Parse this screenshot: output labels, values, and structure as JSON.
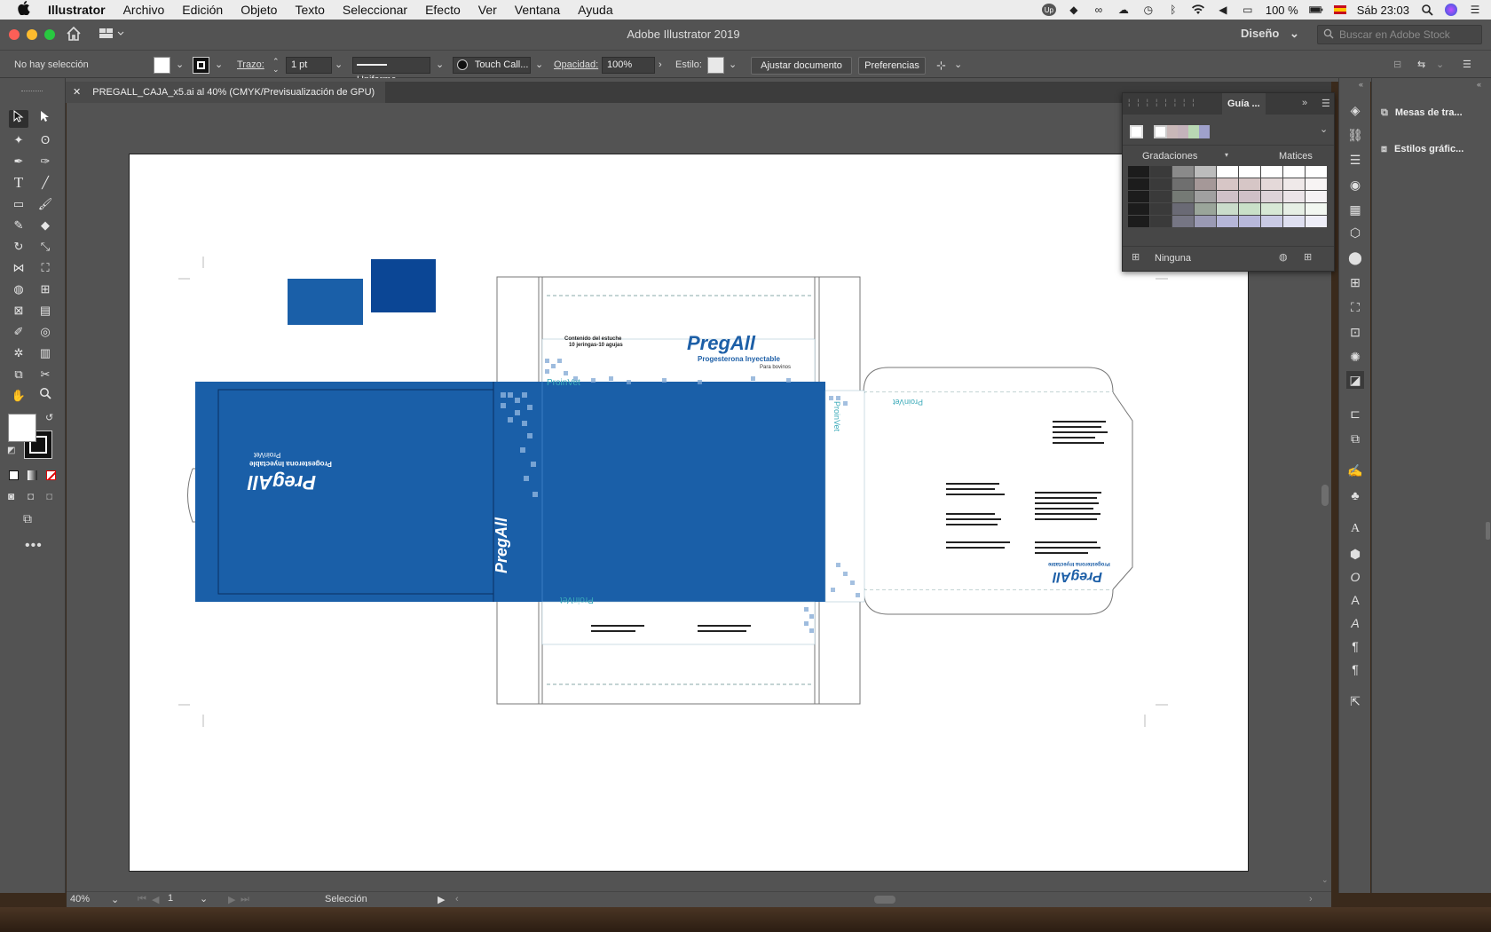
{
  "menubar": {
    "apple": "",
    "app_name": "Illustrator",
    "items": [
      "Archivo",
      "Edición",
      "Objeto",
      "Texto",
      "Seleccionar",
      "Efecto",
      "Ver",
      "Ventana",
      "Ayuda"
    ],
    "battery": "100 %",
    "clock": "Sáb 23:03"
  },
  "titlebar": {
    "title": "Adobe Illustrator 2019",
    "workspace": "Diseño",
    "stock_search_placeholder": "Buscar en Adobe Stock"
  },
  "control_bar": {
    "selection": "No hay selección",
    "stroke_label": "Trazo:",
    "stroke_value": "1 pt",
    "profile": "Uniforme",
    "brush": "Touch Call...",
    "opacity_label": "Opacidad:",
    "opacity_value": "100%",
    "style_label": "Estilo:",
    "adjust_button": "Ajustar documento",
    "prefs_button": "Preferencias"
  },
  "document_tab": {
    "title": "PREGALL_CAJA_x5.ai al 40% (CMYK/Previsualización de GPU)"
  },
  "status_bar": {
    "zoom": "40%",
    "page": "1",
    "tool_status": "Selección"
  },
  "swatch_panel": {
    "tab_label": "Guía ...",
    "gradients_label": "Gradaciones",
    "shades_label": "Matices",
    "footer_label": "Ninguna"
  },
  "right_panels": {
    "artboards": "Mesas de tra...",
    "graphic_styles": "Estilos gráfic..."
  },
  "artwork": {
    "brand": "PregAll",
    "subtitle": "Progesterona Inyectable",
    "for_cattle": "Para bovinos",
    "company": "ProinVet",
    "contents_line1": "Contenido del estuche",
    "contents_line2": "10 jeringas-10 agujas"
  },
  "colors": {
    "ui_bg": "#535353",
    "box_blue": "#1a5fa8",
    "box_blue_dark": "#0b4695",
    "brand_blue": "#1d5fa7",
    "accent_teal": "#39a9b8"
  }
}
